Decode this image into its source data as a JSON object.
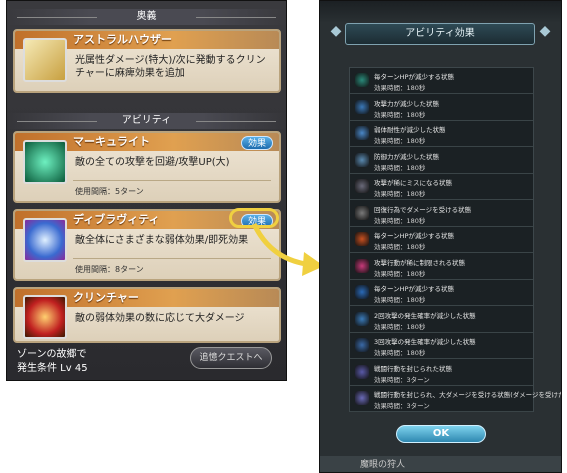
{
  "left": {
    "section_ougi": "奥義",
    "section_ability": "アビリティ",
    "cards": [
      {
        "name": "アストラルハウザー",
        "desc": "光属性ダメージ(特大)/次に発動するクリンチャーに麻痺効果を追加",
        "meta": "",
        "badge": ""
      },
      {
        "name": "マーキュライト",
        "desc": "敵の全ての攻撃を回避/攻撃UP(大)",
        "meta": "使用間隔：5ターン",
        "badge": "効果"
      },
      {
        "name": "ディブラヴィティ",
        "desc": "敵全体にさまざまな弱体効果/即死効果",
        "meta": "使用間隔：8ターン",
        "badge": "効果"
      },
      {
        "name": "クリンチャー",
        "desc": "敵の弱体効果の数に応じて大ダメージ",
        "meta": "",
        "badge": ""
      }
    ],
    "footer_line1": "ゾーンの故郷で",
    "footer_line2": "発生条件 Lv 45",
    "quest_button": "追憶クエストへ"
  },
  "right": {
    "title": "アビリティ効果",
    "ok_label": "OK",
    "bottom_text": "魔眼の狩人",
    "effects": [
      {
        "title": "毎ターンHPが減少する状態",
        "dur": "効果時間：180秒",
        "color": "#2a8a7a"
      },
      {
        "title": "攻撃力が減少した状態",
        "dur": "効果時間：180秒",
        "color": "#3a78b8"
      },
      {
        "title": "弱体耐性が減少した状態",
        "dur": "効果時間：180秒",
        "color": "#4a88c8"
      },
      {
        "title": "防御力が減少した状態",
        "dur": "効果時間：180秒",
        "color": "#5a8ab0"
      },
      {
        "title": "攻撃が稀にミスになる状態",
        "dur": "効果時間：180秒",
        "color": "#6a6a7a"
      },
      {
        "title": "回復行為でダメージを受ける状態",
        "dur": "効果時間：180秒",
        "color": "#7a7a7a"
      },
      {
        "title": "毎ターンHPが減少する状態",
        "dur": "効果時間：180秒",
        "color": "#c85020"
      },
      {
        "title": "攻撃行動が稀に制限される状態",
        "dur": "効果時間：180秒",
        "color": "#c83a7a"
      },
      {
        "title": "毎ターンHPが減少する状態",
        "dur": "効果時間：180秒",
        "color": "#2a6ab8"
      },
      {
        "title": "2回攻撃の発生確率が減少した状態",
        "dur": "効果時間：180秒",
        "color": "#3a7ab8"
      },
      {
        "title": "3回攻撃の発生確率が減少した状態",
        "dur": "効果時間：180秒",
        "color": "#3a6aa8"
      },
      {
        "title": "戦闘行動を封じられた状態",
        "dur": "効果時間：3ターン",
        "color": "#5a5aa8"
      },
      {
        "title": "戦闘行動を封じられ、大ダメージを受ける状態(ダメージを受けた時解除)",
        "dur": "効果時間：3ターン",
        "color": "#6a6ab8"
      }
    ]
  }
}
